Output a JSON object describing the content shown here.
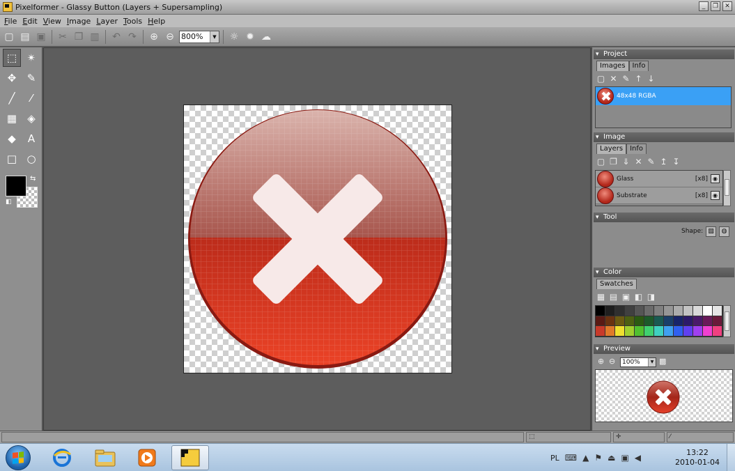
{
  "window": {
    "title": "Pixelformer - Glassy Button (Layers + Supersampling)",
    "buttons": [
      "_",
      "❐",
      "✕"
    ]
  },
  "menu": [
    "File",
    "Edit",
    "View",
    "Image",
    "Layer",
    "Tools",
    "Help"
  ],
  "toolbar": {
    "zoom": "800%",
    "icons": [
      "new-icon",
      "open-icon",
      "save-icon",
      "cut-icon",
      "copy-icon",
      "paste-icon",
      "undo-icon",
      "redo-icon",
      "zoom-in-icon",
      "zoom-out-icon",
      "background-light-icon",
      "background-bright-icon",
      "background-cloud-icon"
    ]
  },
  "panels": {
    "project": {
      "title": "Project",
      "tabs": [
        "Images",
        "Info"
      ],
      "images": [
        {
          "label": "48x48 RGBA"
        }
      ]
    },
    "image": {
      "title": "Image",
      "tabs": [
        "Layers",
        "Info"
      ],
      "layers": [
        {
          "name": "Glass",
          "multiplier": "[x8]"
        },
        {
          "name": "Substrate",
          "multiplier": "[x8]"
        }
      ]
    },
    "tool": {
      "title": "Tool",
      "shape_label": "Shape:"
    },
    "color": {
      "title": "Color",
      "tabs": [
        "Swatches"
      ],
      "swatches": [
        "#000000",
        "#1f1f1f",
        "#2f2f2f",
        "#404040",
        "#555555",
        "#6b6b6b",
        "#808080",
        "#969696",
        "#acacac",
        "#c3c3c3",
        "#d9d9d9",
        "#ffffff",
        "#e5e5e5",
        "#5a1a14",
        "#6a3210",
        "#6b5a12",
        "#4d6012",
        "#2b5a12",
        "#1d5a2a",
        "#1a5a52",
        "#1a3f6a",
        "#18246a",
        "#2c1a6a",
        "#4a1a6a",
        "#6a1a5a",
        "#6a1a3a",
        "#c83a2a",
        "#e07a2a",
        "#f0e030",
        "#a0d030",
        "#50c030",
        "#40d070",
        "#40d0c0",
        "#40a0f0",
        "#3060f0",
        "#6040f0",
        "#a040f0",
        "#f040d0",
        "#f04080"
      ]
    },
    "preview": {
      "title": "Preview",
      "zoom": "100%"
    }
  },
  "taskbar": {
    "language": "PL",
    "time": "13:22",
    "date": "2010-01-04"
  }
}
